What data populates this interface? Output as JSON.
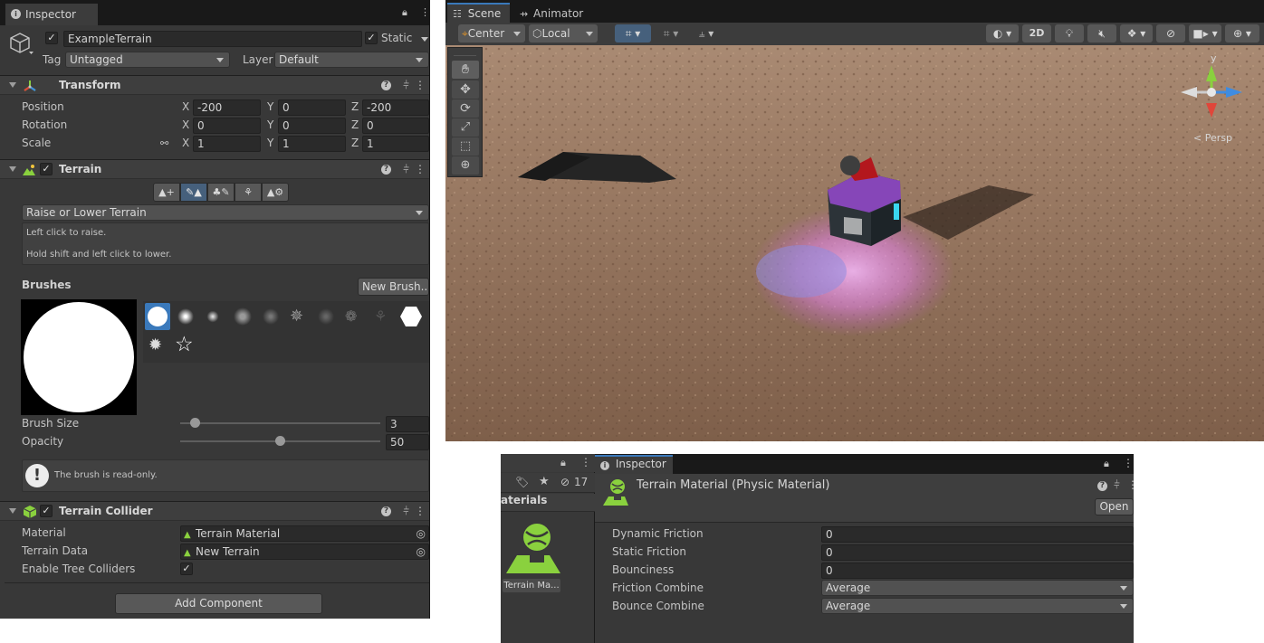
{
  "left_inspector": {
    "tab_label": "Inspector",
    "object_name": "ExampleTerrain",
    "static_label": "Static",
    "tag_label": "Tag",
    "tag_value": "Untagged",
    "layer_label": "Layer",
    "layer_value": "Default",
    "transform": {
      "title": "Transform",
      "position_label": "Position",
      "rotation_label": "Rotation",
      "scale_label": "Scale",
      "axis_x": "X",
      "axis_y": "Y",
      "axis_z": "Z",
      "position": [
        "-200",
        "0",
        "-200"
      ],
      "rotation": [
        "0",
        "0",
        "0"
      ],
      "scale": [
        "1",
        "1",
        "1"
      ]
    },
    "terrain": {
      "title": "Terrain",
      "tool_dropdown": "Raise or Lower Terrain",
      "help_line1": "Left click to raise.",
      "help_line2": "Hold shift and left click to lower.",
      "brushes_label": "Brushes",
      "new_brush_label": "New Brush...",
      "brush_size_label": "Brush Size",
      "brush_size_value": "3",
      "brush_size_fraction": 0.05,
      "opacity_label": "Opacity",
      "opacity_value": "50",
      "opacity_fraction": 0.5,
      "readonly_note": "The brush is read-only."
    },
    "terrain_collider": {
      "title": "Terrain Collider",
      "material_label": "Material",
      "material_value": "Terrain Material",
      "terrain_data_label": "Terrain Data",
      "terrain_data_value": "New Terrain",
      "tree_colliders_label": "Enable Tree Colliders"
    },
    "add_component_label": "Add Component"
  },
  "scene": {
    "scene_tab_label": "Scene",
    "animator_tab_label": "Animator",
    "pivot_label": "Center",
    "space_label": "Local",
    "mode_2d_label": "2D",
    "gizmo_y_label": "y",
    "gizmo_persp_label": "< Persp"
  },
  "bottom": {
    "hidden_count": "17",
    "folder_label": "aterials",
    "asset_label": "Terrain Ma...",
    "inspector_tab_label": "Inspector",
    "asset_title": "Terrain Material (Physic Material)",
    "open_label": "Open",
    "properties": [
      {
        "label": "Dynamic Friction",
        "value": "0"
      },
      {
        "label": "Static Friction",
        "value": "0"
      },
      {
        "label": "Bounciness",
        "value": "0"
      }
    ],
    "friction_combine_label": "Friction Combine",
    "friction_combine_value": "Average",
    "bounce_combine_label": "Bounce Combine",
    "bounce_combine_value": "Average"
  },
  "colors": {
    "panel_bg": "#383838",
    "selection_blue": "#3a79bb",
    "terrain_green": "#8ad13e"
  }
}
